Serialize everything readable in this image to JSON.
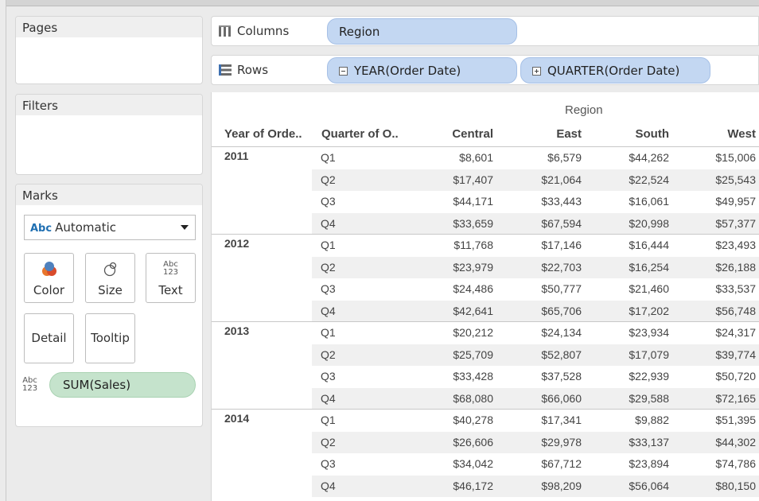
{
  "cards": {
    "pages": "Pages",
    "filters": "Filters",
    "marks": "Marks"
  },
  "marks": {
    "type_abc": "Abc",
    "type_label": "Automatic",
    "buttons": {
      "color": "Color",
      "size": "Size",
      "text": "Text",
      "detail": "Detail",
      "tooltip": "Tooltip"
    },
    "text_icon_top": "Abc",
    "text_icon_bottom": "123",
    "field_icon_top": "Abc",
    "field_icon_bottom": "123",
    "field_pill": "SUM(Sales)"
  },
  "shelves": {
    "columns_label": "Columns",
    "rows_label": "Rows",
    "columns_pill": "Region",
    "rows_pills": [
      "YEAR(Order Date)",
      "QUARTER(Order Date)"
    ]
  },
  "colors": {
    "dimension_pill": "#c3d7f2",
    "measure_pill": "#c5e3cc",
    "row_shade": "#f0f0f0"
  },
  "table": {
    "column_group_header": "Region",
    "headers": [
      "Year of Orde..",
      "Quarter of O..",
      "Central",
      "East",
      "South",
      "West"
    ],
    "years": [
      {
        "year": "2011",
        "rows": [
          {
            "q": "Q1",
            "values": [
              "$8,601",
              "$6,579",
              "$44,262",
              "$15,006"
            ]
          },
          {
            "q": "Q2",
            "values": [
              "$17,407",
              "$21,064",
              "$22,524",
              "$25,543"
            ]
          },
          {
            "q": "Q3",
            "values": [
              "$44,171",
              "$33,443",
              "$16,061",
              "$49,957"
            ]
          },
          {
            "q": "Q4",
            "values": [
              "$33,659",
              "$67,594",
              "$20,998",
              "$57,377"
            ]
          }
        ]
      },
      {
        "year": "2012",
        "rows": [
          {
            "q": "Q1",
            "values": [
              "$11,768",
              "$17,146",
              "$16,444",
              "$23,493"
            ]
          },
          {
            "q": "Q2",
            "values": [
              "$23,979",
              "$22,703",
              "$16,254",
              "$26,188"
            ]
          },
          {
            "q": "Q3",
            "values": [
              "$24,486",
              "$50,777",
              "$21,460",
              "$33,537"
            ]
          },
          {
            "q": "Q4",
            "values": [
              "$42,641",
              "$65,706",
              "$17,202",
              "$56,748"
            ]
          }
        ]
      },
      {
        "year": "2013",
        "rows": [
          {
            "q": "Q1",
            "values": [
              "$20,212",
              "$24,134",
              "$23,934",
              "$24,317"
            ]
          },
          {
            "q": "Q2",
            "values": [
              "$25,709",
              "$52,807",
              "$17,079",
              "$39,774"
            ]
          },
          {
            "q": "Q3",
            "values": [
              "$33,428",
              "$37,528",
              "$22,939",
              "$50,720"
            ]
          },
          {
            "q": "Q4",
            "values": [
              "$68,080",
              "$66,060",
              "$29,588",
              "$72,165"
            ]
          }
        ]
      },
      {
        "year": "2014",
        "rows": [
          {
            "q": "Q1",
            "values": [
              "$40,278",
              "$17,341",
              "$9,882",
              "$51,395"
            ]
          },
          {
            "q": "Q2",
            "values": [
              "$26,606",
              "$29,978",
              "$33,137",
              "$44,302"
            ]
          },
          {
            "q": "Q3",
            "values": [
              "$34,042",
              "$67,712",
              "$23,894",
              "$74,786"
            ]
          },
          {
            "q": "Q4",
            "values": [
              "$46,172",
              "$98,209",
              "$56,064",
              "$80,150"
            ]
          }
        ]
      }
    ]
  }
}
